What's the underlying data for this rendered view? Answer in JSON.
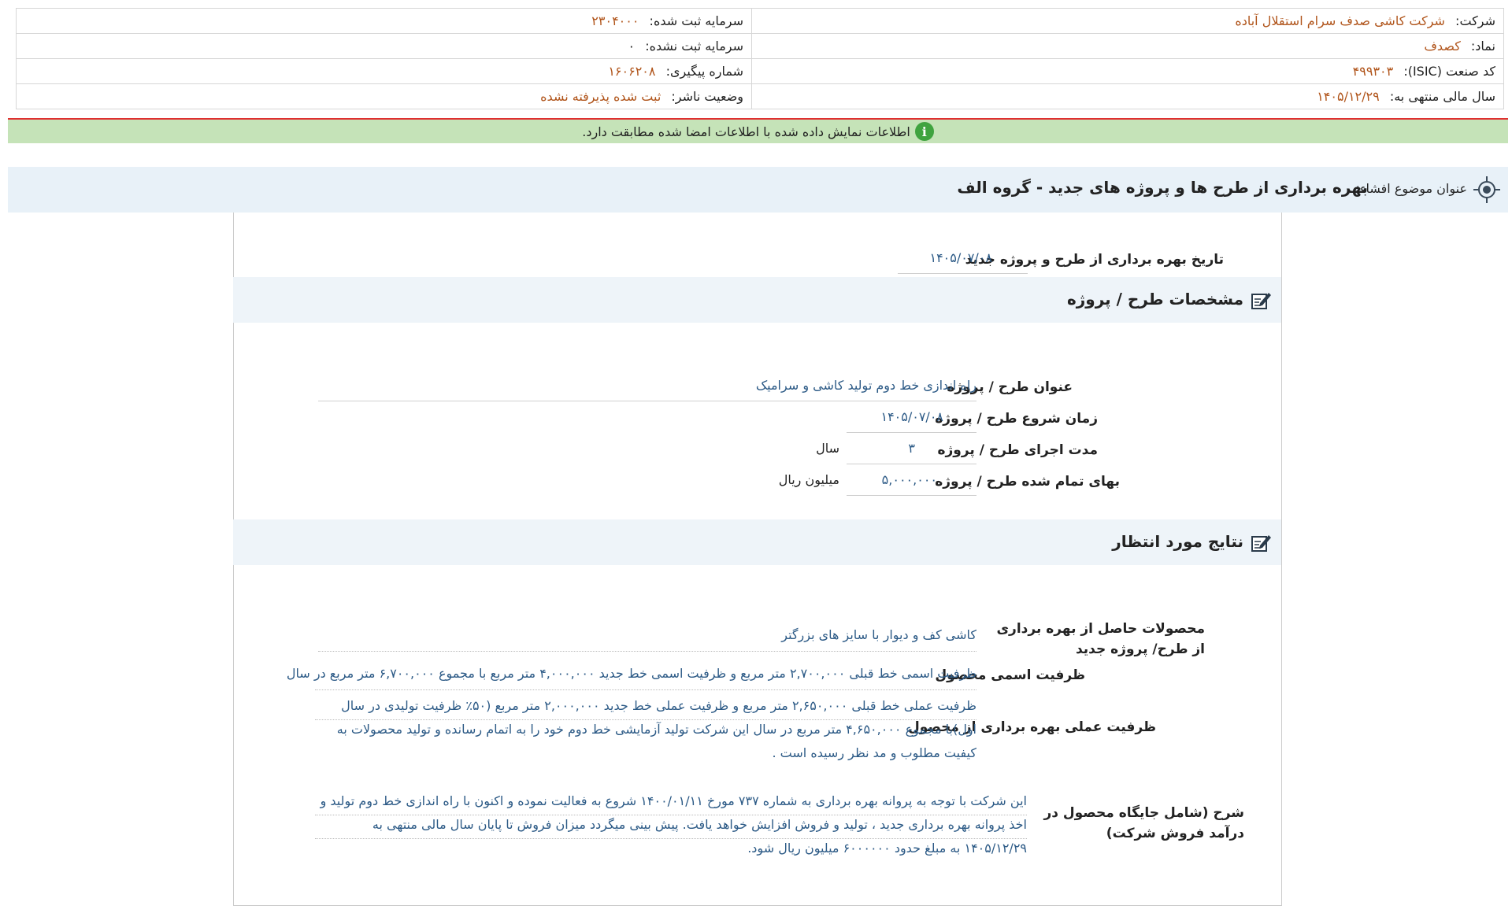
{
  "company_info": {
    "company_label": "شرکت:",
    "company_value": "شرکت کاشی صدف سرام استقلال آباده",
    "registered_capital_label": "سرمایه ثبت شده:",
    "registered_capital_value": "۲۳۰۴۰۰۰",
    "symbol_label": "نماد:",
    "symbol_value": "کصدف",
    "unregistered_capital_label": "سرمایه ثبت نشده:",
    "unregistered_capital_value": "۰",
    "isic_label": "کد صنعت (ISIC):",
    "isic_value": "۴۹۹۳۰۳",
    "tracking_label": "شماره پیگیری:",
    "tracking_value": "۱۶۰۶۲۰۸",
    "fiscal_year_label": "سال مالی منتهی به:",
    "fiscal_year_value": "۱۴۰۵/۱۲/۲۹",
    "publisher_status_label": "وضعیت ناشر:",
    "publisher_status_value": "ثبت شده پذیرفته نشده"
  },
  "notice": {
    "icon": "info-icon",
    "text": "اطلاعات نمایش داده شده با اطلاعات امضا شده مطابقت دارد."
  },
  "subject": {
    "icon": "target-icon",
    "label": "عنوان موضوع افشاء:",
    "title": "بهره برداری از طرح ها و پروژه های جدید - گروه الف"
  },
  "exploitation_date": {
    "label": "تاریخ بهره برداری از طرح و پروژه جدید",
    "value": "۱۴۰۵/۰۷/۰۸"
  },
  "project_specs": {
    "icon": "edit-icon",
    "title": "مشخصات طرح / پروژه",
    "title_label": "عنوان طرح / پروژه",
    "title_value": "راه اندازی خط دوم تولید کاشی و سرامیک",
    "start_label": "زمان شروع طرح / پروژه",
    "start_value": "۱۴۰۵/۰۷/۰۸",
    "duration_label": "مدت اجرای طرح / پروژه",
    "duration_value": "۳",
    "duration_unit": "سال",
    "cost_label": "بهای تمام شده طرح / پروژه",
    "cost_value": "۵,۰۰۰,۰۰۰",
    "cost_unit": "میلیون ریال"
  },
  "expected_results": {
    "icon": "edit-icon",
    "title": "نتایج مورد انتظار",
    "products_label": "محصولات حاصل از بهره برداری از طرح/ پروژه جدید",
    "products_value": "کاشی کف و دیوار با سایز های بزرگتر",
    "nominal_label": "ظرفیت اسمی محصول",
    "nominal_value": "ظرفیت اسمی خط قبلی ۲,۷۰۰,۰۰۰ متر مربع و ظرفیت اسمی خط جدید ۴,۰۰۰,۰۰۰ متر مربع با مجموع ۶,۷۰۰,۰۰۰ متر مربع در سال",
    "practical_label": "ظرفیت عملی بهره برداری از محصول",
    "practical_value": "ظرفیت عملی خط قبلی ۲,۶۵۰,۰۰۰ متر مربع و ظرفیت عملی خط جدید ۲,۰۰۰,۰۰۰ متر مربع (۵۰٪ ظرفیت تولیدی در سال اول)با مجموع ۴,۶۵۰,۰۰۰ متر مربع در سال این شرکت تولید آزمایشی خط دوم خود را به اتمام رسانده و تولید محصولات به کیفیت مطلوب و مد نظر رسیده است .",
    "description_label": "شرح (شامل جایگاه محصول در درآمد فروش شرکت)",
    "description_value": "این شرکت با توجه به پروانه بهره برداری به شماره ۷۳۷ مورخ ۱۴۰۰/۰۱/۱۱ شروع به فعالیت نموده و اکنون با راه اندازی خط دوم تولید و اخذ پروانه بهره برداری جدید ، تولید و فروش افزایش خواهد یافت. پیش بینی میگردد میزان فروش تا پایان سال مالی منتهی به ۱۴۰۵/۱۲/۲۹ به مبلغ حدود ۶۰۰۰۰۰۰ میلیون ریال شود."
  }
}
